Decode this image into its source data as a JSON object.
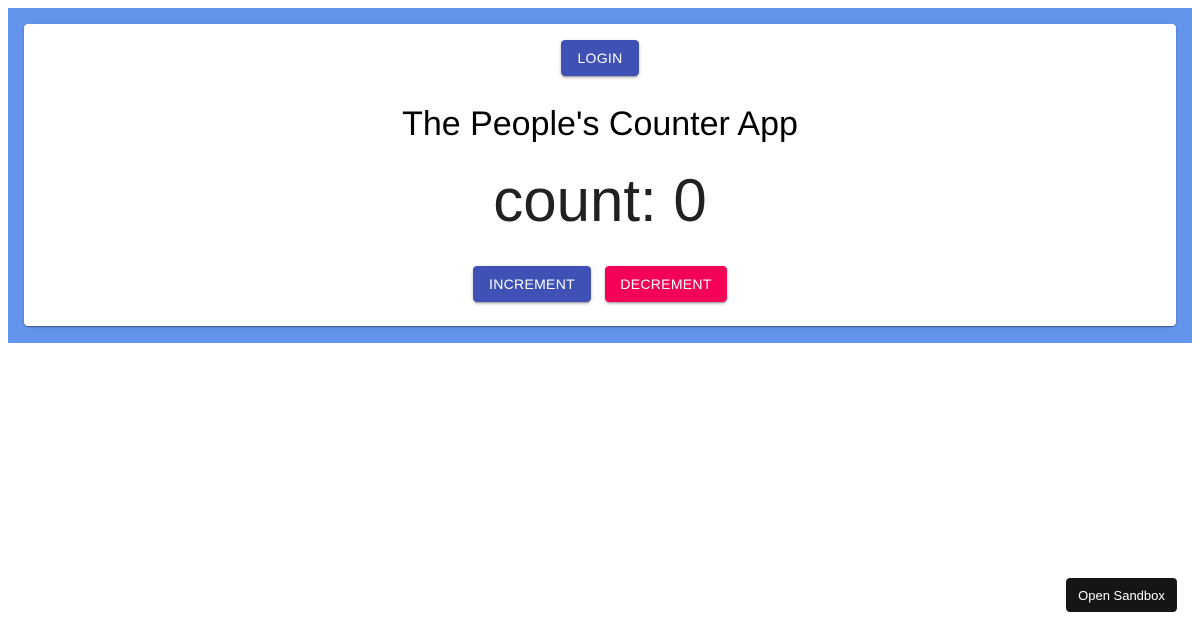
{
  "header": {
    "login_label": "LOGIN"
  },
  "main": {
    "title": "The People's Counter App",
    "count_text": "count: 0",
    "increment_label": "INCREMENT",
    "decrement_label": "DECREMENT"
  },
  "footer": {
    "sandbox_label": "Open Sandbox"
  },
  "colors": {
    "background_banner": "#6495ed",
    "primary": "#3f51b5",
    "secondary": "#f50057",
    "sandbox_button": "#151515"
  }
}
